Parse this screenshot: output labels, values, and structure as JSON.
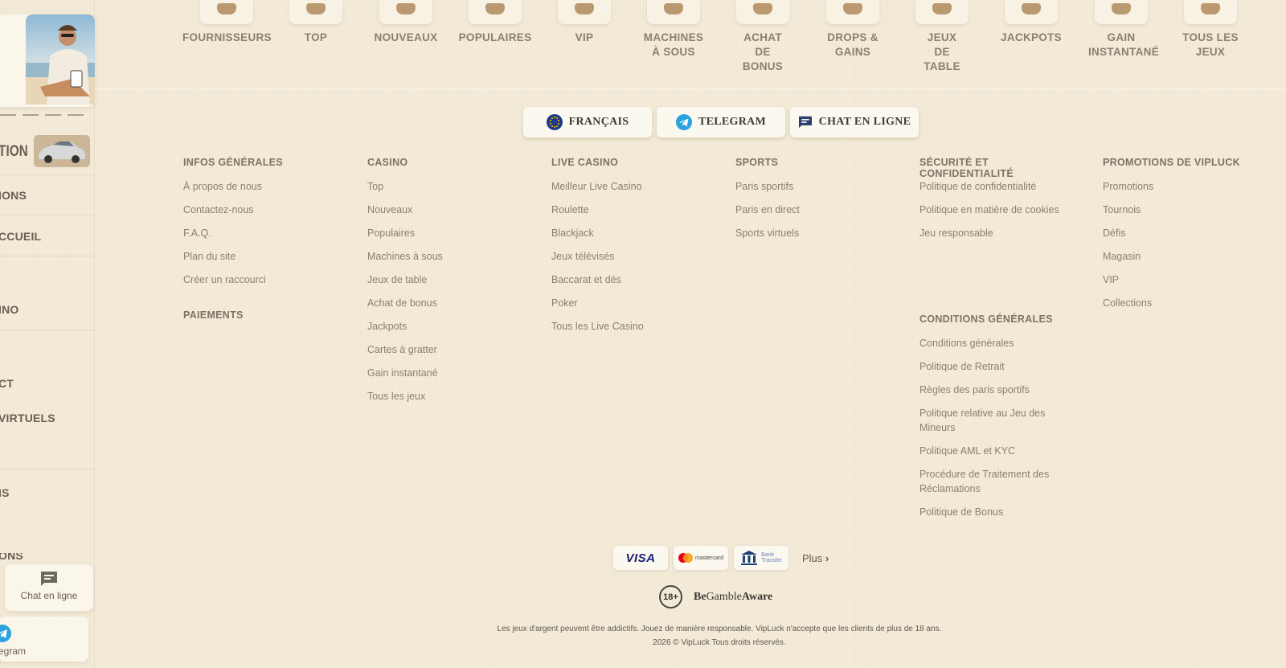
{
  "categories": [
    {
      "label": "FOURNISSEURS"
    },
    {
      "label": "TOP"
    },
    {
      "label": "NOUVEAUX"
    },
    {
      "label": "POPULAIRES"
    },
    {
      "label": "VIP"
    },
    {
      "label": "MACHINES À SOUS"
    },
    {
      "label": "ACHAT DE BONUS"
    },
    {
      "label": "DROPS & GAINS"
    },
    {
      "label": "JEUX DE TABLE"
    },
    {
      "label": "JACKPOTS"
    },
    {
      "label": "GAIN INSTANTANÉ"
    },
    {
      "label": "TOUS LES JEUX"
    }
  ],
  "sidebar": {
    "car_label": "TION",
    "items": [
      "IONS",
      "CCUEIL",
      "INO",
      "CT",
      "VIRTUELS",
      "IS",
      "ONS"
    ],
    "chat_label": "Chat en ligne",
    "telegram_label": "egram"
  },
  "top_buttons": {
    "language": "FRANÇAIS",
    "telegram": "TELEGRAM",
    "chat": "CHAT EN LIGNE"
  },
  "columns": {
    "infos": {
      "title": "INFOS GÉNÉRALES",
      "links": [
        "À propos de nous",
        "Contactez-nous",
        "F.A.Q.",
        "Plan du site",
        "Créer un raccourci"
      ]
    },
    "paiements": {
      "title": "PAIEMENTS"
    },
    "casino": {
      "title": "CASINO",
      "links": [
        "Top",
        "Nouveaux",
        "Populaires",
        "Machines à sous",
        "Jeux de table",
        "Achat de bonus",
        "Jackpots",
        "Cartes à gratter",
        "Gain instantané",
        "Tous les jeux"
      ]
    },
    "live": {
      "title": "LIVE CASINO",
      "links": [
        "Meilleur Live Casino",
        "Roulette",
        "Blackjack",
        "Jeux télévisés",
        "Baccarat et dés",
        "Poker",
        "Tous les Live Casino"
      ]
    },
    "sports": {
      "title": "SPORTS",
      "links": [
        "Paris sportifs",
        "Paris en direct",
        "Sports virtuels"
      ]
    },
    "securite": {
      "title": "SÉCURITÉ ET CONFIDENTIALITÉ",
      "links": [
        "Politique de confidentialité",
        "Politique en matière de cookies",
        "Jeu responsable"
      ]
    },
    "conditions": {
      "title": "CONDITIONS GÉNÉRALES",
      "links": [
        "Conditions générales",
        "Politique de Retrait",
        "Règles des paris sportifs",
        "Politique relative au Jeu des Mineurs",
        "Politique AML et KYC",
        "Procédure de Traitement des Réclamations",
        "Politique de Bonus"
      ]
    },
    "promos": {
      "title": "PROMOTIONS DE VIPLUCK",
      "links": [
        "Promotions",
        "Tournois",
        "Défis",
        "Magasin",
        "VIP",
        "Collections"
      ]
    }
  },
  "payments": {
    "visa": "VISA",
    "mastercard": "mastercard",
    "bank_line1": "Bank",
    "bank_line2": "Transfer",
    "more": "Plus"
  },
  "gamble": {
    "age": "18+",
    "be": "Be",
    "gamble": "Gamble",
    "aware": "Aware"
  },
  "disclaimer": {
    "line1": "Les jeux d'argent peuvent être addictifs. Jouez de manière responsable. VipLuck n'accepte que les clients de plus de 18 ans.",
    "line2": "2026 © VipLuck Tous droits réservés."
  },
  "colors": {
    "background": "#f3ead8",
    "card": "#fbf8f0",
    "text": "#8a806f",
    "heading": "#7d7365",
    "visa": "#1a1f71"
  }
}
